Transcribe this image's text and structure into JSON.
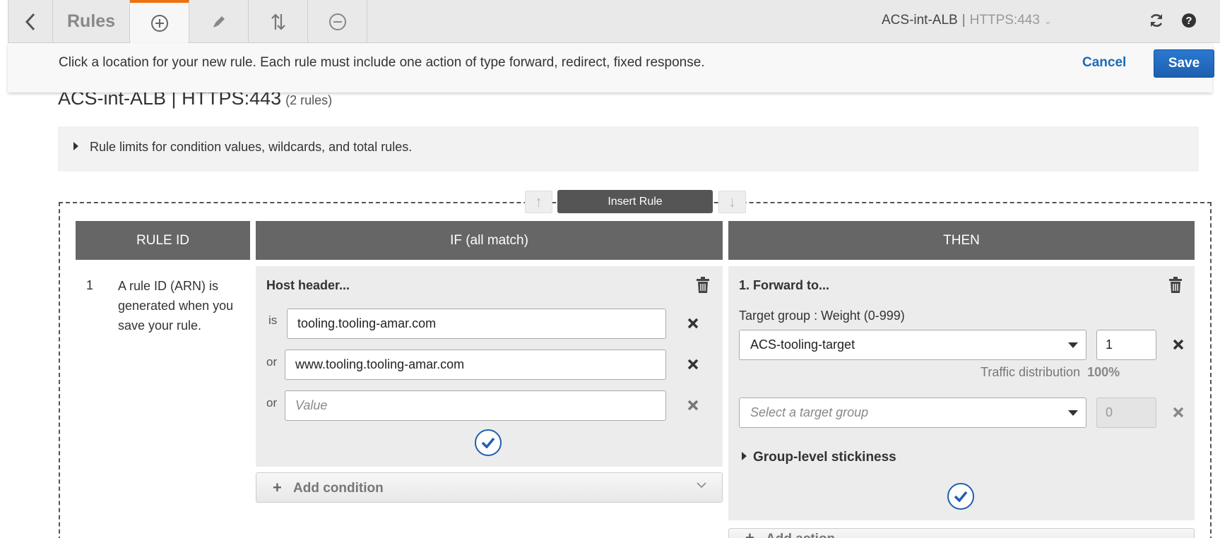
{
  "toolbar": {
    "title": "Rules",
    "load_balancer": "ACS-int-ALB",
    "separator": "|",
    "listener": "HTTPS:443"
  },
  "banner": {
    "message": "Click a location for your new rule. Each rule must include one action of type forward, redirect, fixed response.",
    "cancel_label": "Cancel",
    "save_label": "Save"
  },
  "heading": {
    "title": "ACS-int-ALB | HTTPS:443",
    "rule_count": "(2 rules)"
  },
  "limits": {
    "label": "Rule limits for condition values, wildcards, and total rules."
  },
  "insert": {
    "label": "Insert Rule"
  },
  "columns": {
    "rule_id": "RULE ID",
    "if": "IF (all match)",
    "then": "THEN"
  },
  "rule": {
    "number": "1",
    "note": "A rule ID (ARN) is generated when you save your rule.",
    "condition": {
      "title": "Host header...",
      "values": [
        {
          "op": "is",
          "value": "tooling.tooling-amar.com"
        },
        {
          "op": "or",
          "value": "www.tooling.tooling-amar.com"
        },
        {
          "op": "or",
          "placeholder": "Value"
        }
      ]
    },
    "add_condition": "Add condition",
    "action": {
      "title": "1. Forward to...",
      "target_label": "Target group : Weight (0-999)",
      "targets": [
        {
          "group": "ACS-tooling-target",
          "weight": "1"
        },
        {
          "placeholder": "Select a target group",
          "weight": "0"
        }
      ],
      "traffic_label": "Traffic distribution",
      "traffic_value": "100%",
      "stickiness": "Group-level stickiness"
    },
    "add_action": "Add action"
  },
  "colors": {
    "accent_tab": "#ec7211",
    "primary_button": "#1e5fb0",
    "link": "#1a6bb8",
    "column_header": "#666666"
  }
}
